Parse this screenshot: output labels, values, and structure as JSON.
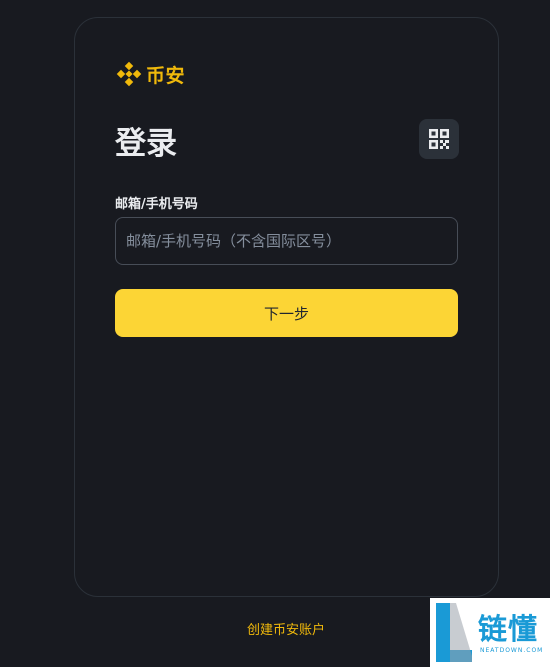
{
  "brand": {
    "name": "币安",
    "color": "#f0b90b"
  },
  "login": {
    "title": "登录",
    "qr_icon": "qr-code-icon",
    "field_label": "邮箱/手机号码",
    "input_value": "",
    "input_placeholder": "邮箱/手机号码（不含国际区号）",
    "next_button": "下一步",
    "accent_color": "#fcd535"
  },
  "footer": {
    "create_account": "创建币安账户"
  },
  "watermark": {
    "text": "链懂",
    "subtext": "NEATDOWN.COM"
  }
}
